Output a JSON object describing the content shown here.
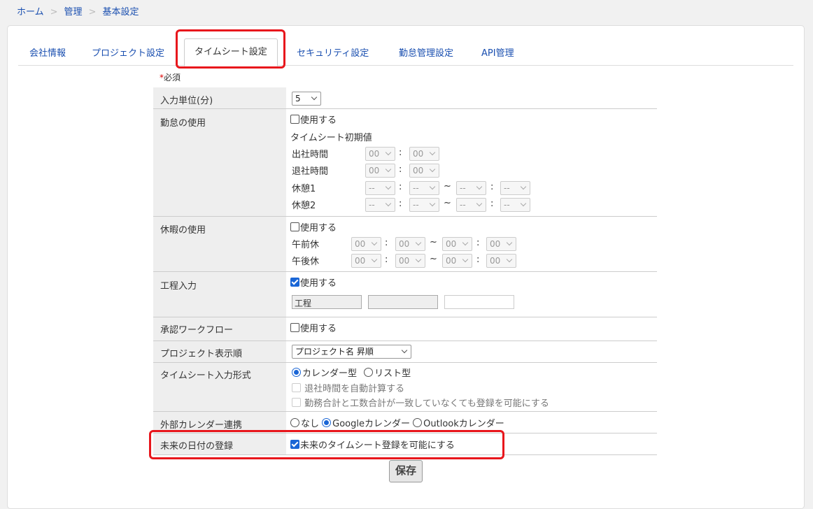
{
  "breadcrumb": {
    "home": "ホーム",
    "admin": "管理",
    "current": "基本設定",
    "sep": ">"
  },
  "tabs": {
    "company": "会社情報",
    "project": "プロジェクト設定",
    "timesheet": "タイムシート設定",
    "security": "セキュリティ設定",
    "attendance": "勤怠管理設定",
    "api": "API管理"
  },
  "required": {
    "mark": "*",
    "text": "必須"
  },
  "input_unit": {
    "label": "入力単位(分)",
    "value": "5"
  },
  "attendance_use": {
    "label": "勤怠の使用",
    "checkbox": "使用する",
    "defaults_title": "タイムシート初期値",
    "clock_in": {
      "label": "出社時間",
      "h": "00",
      "m": "00"
    },
    "clock_out": {
      "label": "退社時間",
      "h": "00",
      "m": "00"
    },
    "break1": {
      "label": "休憩1",
      "h1": "--",
      "m1": "--",
      "h2": "--",
      "m2": "--"
    },
    "break2": {
      "label": "休憩2",
      "h1": "--",
      "m1": "--",
      "h2": "--",
      "m2": "--"
    },
    "colon": ":",
    "tilde": "~"
  },
  "leave_use": {
    "label": "休暇の使用",
    "checkbox": "使用する",
    "am": {
      "label": "午前休",
      "h1": "00",
      "m1": "00",
      "h2": "00",
      "m2": "00"
    },
    "pm": {
      "label": "午後休",
      "h1": "00",
      "m1": "00",
      "h2": "00",
      "m2": "00"
    }
  },
  "process_input": {
    "label": "工程入力",
    "checkbox": "使用する",
    "field1": "工程",
    "field2": "",
    "field3": ""
  },
  "approval_workflow": {
    "label": "承認ワークフロー",
    "checkbox": "使用する"
  },
  "project_order": {
    "label": "プロジェクト表示順",
    "value": "プロジェクト名 昇順"
  },
  "timesheet_format": {
    "label": "タイムシート入力形式",
    "radio_calendar": "カレンダー型",
    "radio_list": "リスト型",
    "auto_calc": "退社時間を自動計算する",
    "allow_mismatch": "勤務合計と工数合計が一致していなくても登録を可能にする"
  },
  "external_calendar": {
    "label": "外部カレンダー連携",
    "none": "なし",
    "google": "Googleカレンダー",
    "outlook": "Outlookカレンダー"
  },
  "future_date": {
    "label": "未来の日付の登録",
    "checkbox": "未来のタイムシート登録を可能にする"
  },
  "save_button": "保存",
  "colors": {
    "link": "#1a4fb0",
    "highlight": "#e8161c",
    "check": "#1a66d6"
  }
}
